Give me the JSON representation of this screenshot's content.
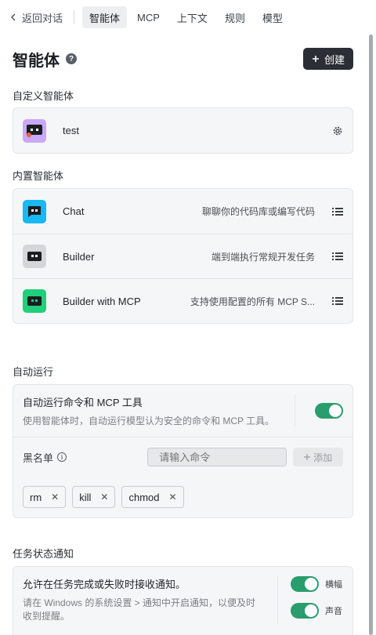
{
  "nav": {
    "back_label": "返回对话",
    "tabs": [
      {
        "label": "智能体",
        "active": true
      },
      {
        "label": "MCP"
      },
      {
        "label": "上下文"
      },
      {
        "label": "规则"
      },
      {
        "label": "模型"
      }
    ]
  },
  "header": {
    "title": "智能体",
    "help_icon": "help-icon",
    "create_label": "创建"
  },
  "custom": {
    "section_label": "自定义智能体",
    "items": [
      {
        "name": "test",
        "icon_color": "#c9a8f5"
      }
    ]
  },
  "builtin": {
    "section_label": "内置智能体",
    "items": [
      {
        "name": "Chat",
        "desc": "聊聊你的代码库或编写代码",
        "icon_color": "#18b8f2"
      },
      {
        "name": "Builder",
        "desc": "端到端执行常规开发任务",
        "icon_color": "#d4d6d9"
      },
      {
        "name": "Builder with MCP",
        "desc": "支持使用配置的所有 MCP S...",
        "icon_color": "#1fcf7a"
      }
    ]
  },
  "auto_run": {
    "section_label": "自动运行",
    "title": "自动运行命令和 MCP 工具",
    "subtitle": "使用智能体时，自动运行模型认为安全的命令和 MCP 工具。",
    "enabled": true,
    "blacklist_label": "黑名单",
    "input_placeholder": "请输入命令",
    "add_label": "添加",
    "chips": [
      "rm",
      "kill",
      "chmod"
    ]
  },
  "notify": {
    "section_label": "任务状态通知",
    "title": "允许在任务完成或失败时接收通知。",
    "subtitle": "请在 Windows 的系统设置 > 通知中开启通知，以便及时收到提醒。",
    "toggles": [
      {
        "label": "横幅",
        "enabled": true
      },
      {
        "label": "声音",
        "enabled": true
      }
    ]
  },
  "colors": {
    "accent_toggle": "#2a9d6f",
    "create_button": "#2b2f35"
  }
}
